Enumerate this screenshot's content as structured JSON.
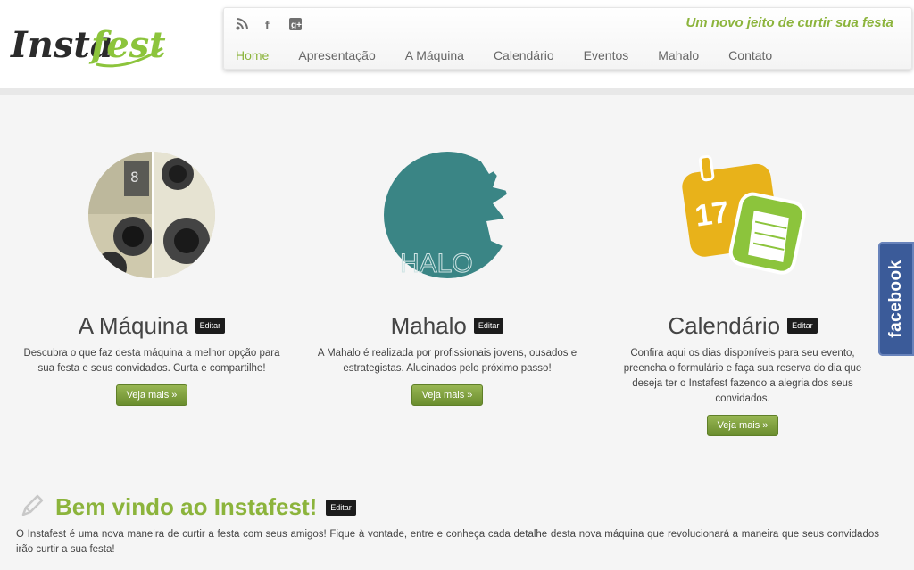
{
  "header": {
    "logo_text": "Instafest",
    "tagline": "Um novo jeito de curtir sua festa",
    "social_icons": [
      "rss-icon",
      "facebook-icon",
      "google-plus-icon"
    ],
    "nav": [
      {
        "label": "Home",
        "active": true
      },
      {
        "label": "Apresentação",
        "active": false
      },
      {
        "label": "A Máquina",
        "active": false
      },
      {
        "label": "Calendário",
        "active": false
      },
      {
        "label": "Eventos",
        "active": false
      },
      {
        "label": "Mahalo",
        "active": false
      },
      {
        "label": "Contato",
        "active": false
      }
    ]
  },
  "features": [
    {
      "title": "A Máquina",
      "edit_label": "Editar",
      "description": "Descubra o que faz desta máquina a melhor opção para sua festa e seus convidados. Curta e compartilhe!",
      "button": "Veja mais »",
      "image_icon": "camera-collage-icon"
    },
    {
      "title": "Mahalo",
      "edit_label": "Editar",
      "description": "A Mahalo é realizada por profissionais jovens, ousados e estrategistas. Alucinados pelo próximo passo!",
      "button": "Veja mais »",
      "image_icon": "mahalo-logo-icon",
      "image_text": "HALO"
    },
    {
      "title": "Calendário",
      "edit_label": "Editar",
      "description": "Confira aqui os dias disponíveis para seu evento, preencha o formulário e faça sua reserva do dia que deseja ter o Instafest fazendo a alegria dos seus convidados.",
      "button": "Veja mais »",
      "image_icon": "calendar-icon",
      "image_text": "17"
    }
  ],
  "welcome": {
    "icon": "pencil-icon",
    "title": "Bem vindo ao Instafest!",
    "edit_label": "Editar",
    "text": "O Instafest é uma nova maneira de curtir a festa com seus amigos! Fique à vontade, entre e conheça cada detalhe desta nova máquina que revolucionará a maneira que seus convidados irão curtir a sua festa!"
  },
  "facebook_tab": {
    "label": "facebook"
  },
  "colors": {
    "brand_green": "#8cb43c",
    "facebook_blue": "#3b5b99",
    "teal": "#3a8585",
    "calendar_yellow": "#e8b21a"
  }
}
